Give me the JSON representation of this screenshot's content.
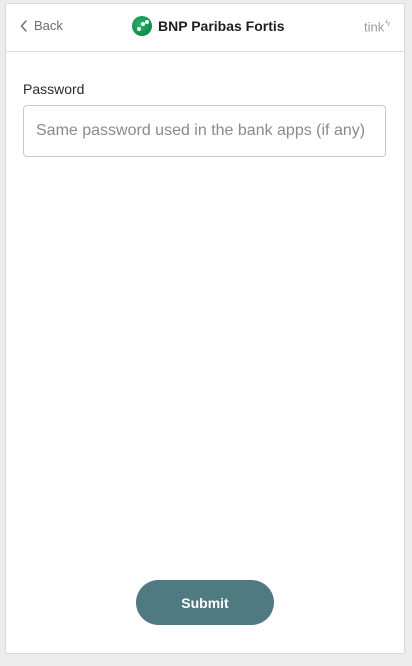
{
  "header": {
    "back_label": "Back",
    "bank_name": "BNP Paribas Fortis",
    "provider": "tink"
  },
  "form": {
    "password_label": "Password",
    "password_placeholder": "Same password used in the bank apps (if any)",
    "password_value": ""
  },
  "actions": {
    "submit_label": "Submit"
  },
  "colors": {
    "accent": "#4f7a82",
    "brand_green": "#0f8a4d",
    "border": "#c9c9c9"
  },
  "icons": {
    "back": "chevron-left-icon",
    "bank_logo": "bnp-paribas-logo-icon",
    "tink_mark": "tink-logo-icon"
  }
}
